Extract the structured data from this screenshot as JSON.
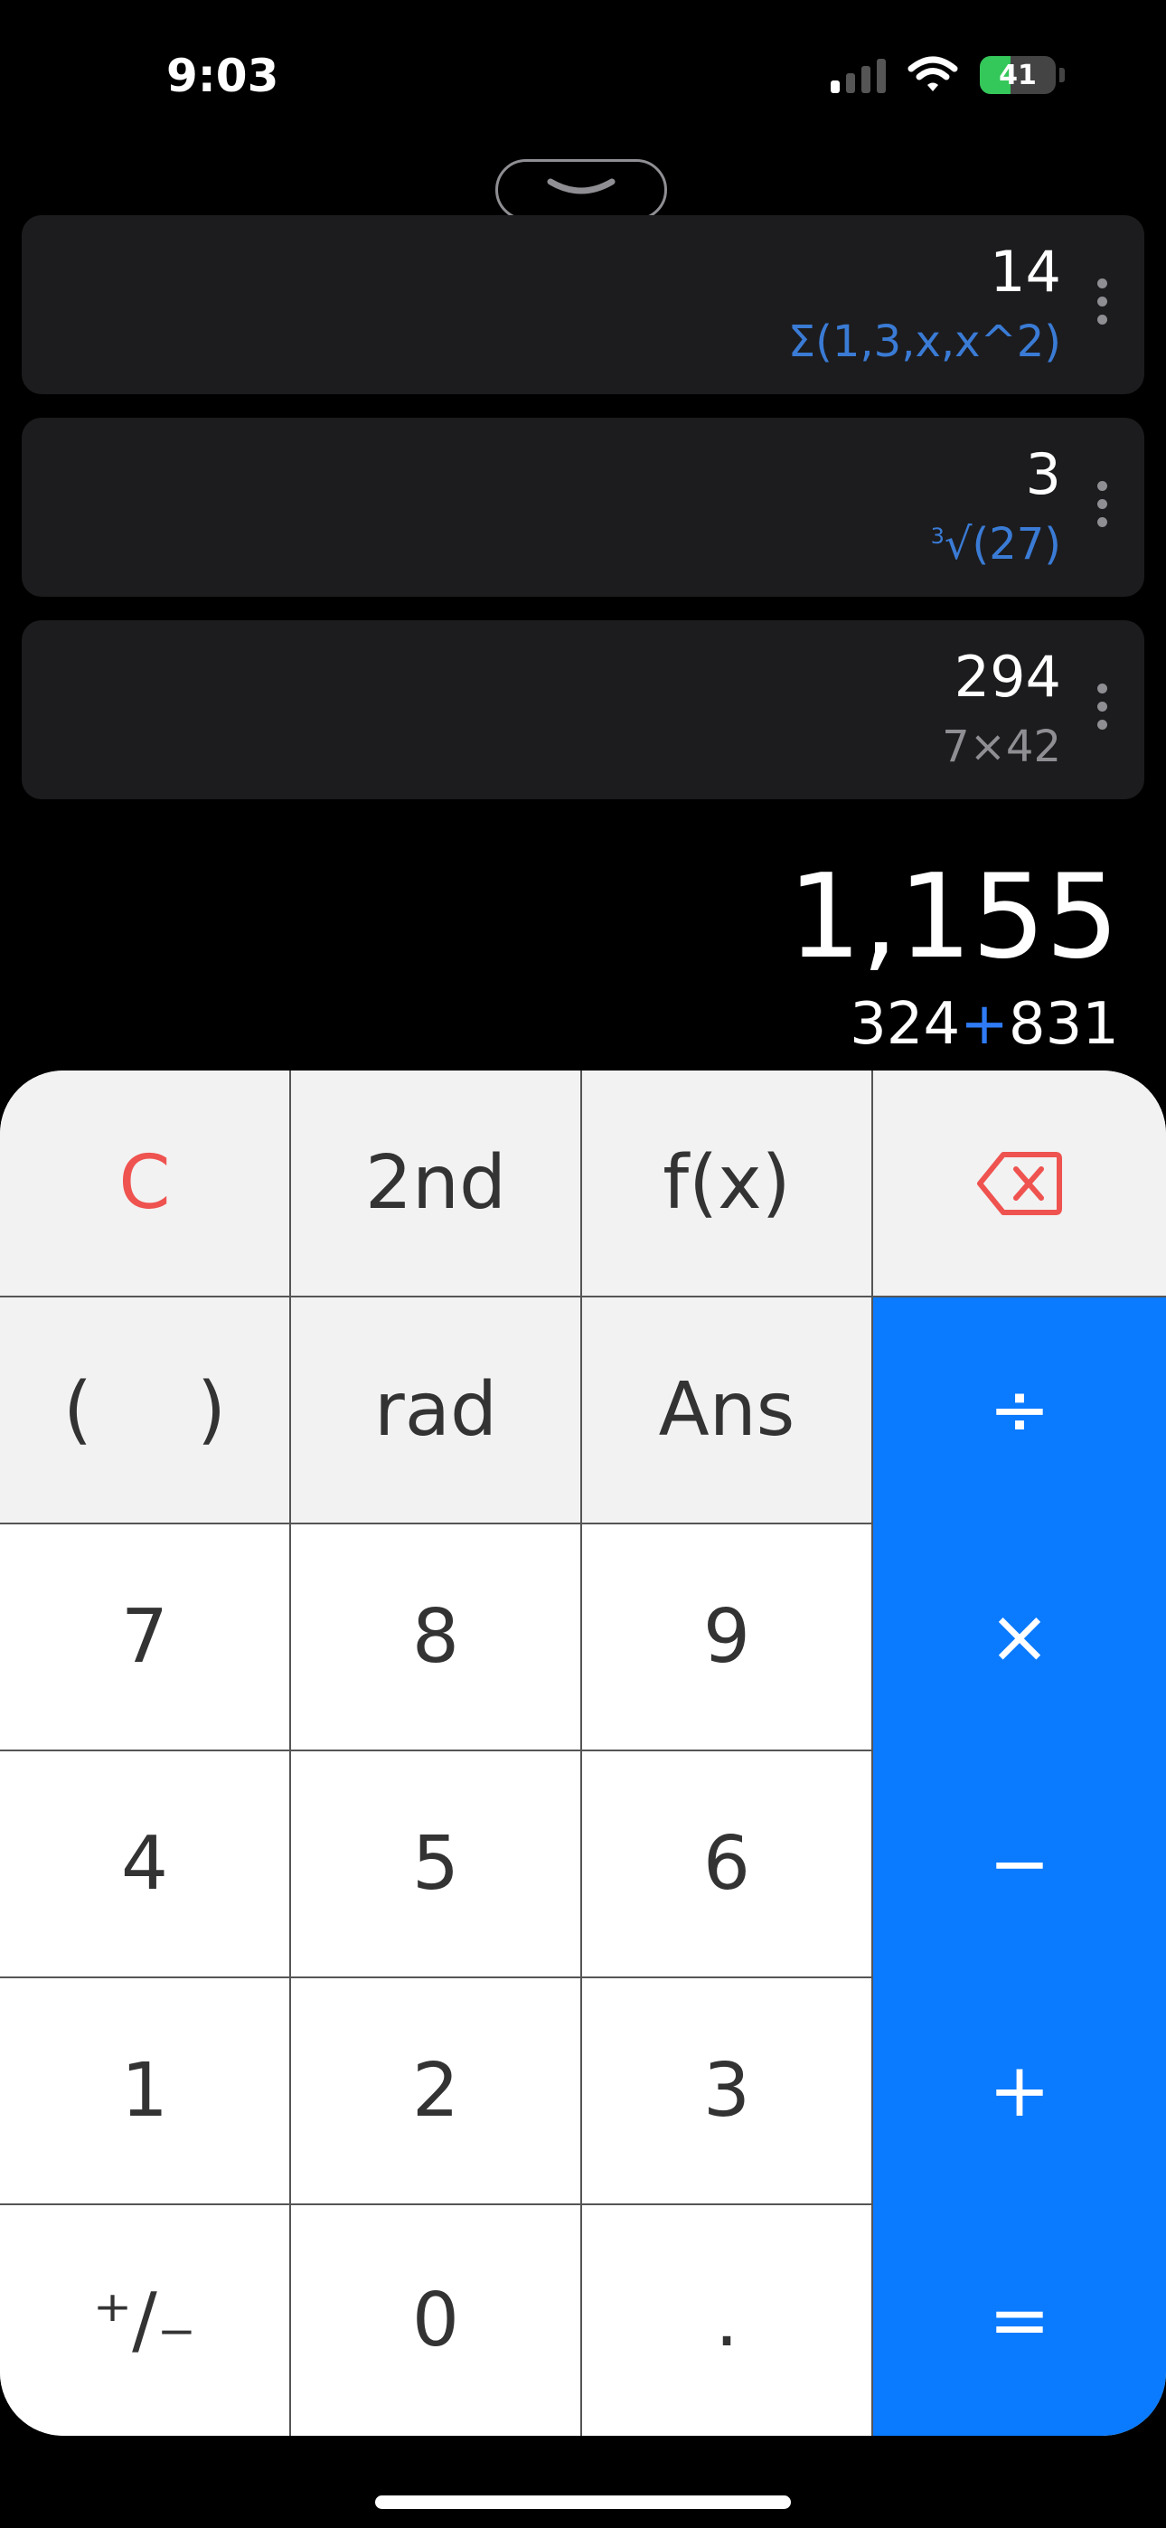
{
  "status_bar": {
    "time": "9:03",
    "battery": "41"
  },
  "history": [
    {
      "result": "14",
      "expr": "Σ(1,3,x,x^2)"
    },
    {
      "result": "3",
      "expr_index": "3",
      "expr_rest": "√(27)"
    },
    {
      "result": "294",
      "expr": "7×42"
    }
  ],
  "display": {
    "result": "1,155",
    "expr_left": "324",
    "expr_op": "+",
    "expr_right": "831"
  },
  "keys": {
    "clear": "C",
    "second": "2nd",
    "fx": "f(x)",
    "paren_open": "(",
    "paren_close": ")",
    "rad": "rad",
    "ans": "Ans",
    "divide": "÷",
    "seven": "7",
    "eight": "8",
    "nine": "9",
    "multiply": "×",
    "four": "4",
    "five": "5",
    "six": "6",
    "minus": "−",
    "one": "1",
    "two": "2",
    "three": "3",
    "plus": "+",
    "plus_minus": "⁺∕₋",
    "zero": "0",
    "dot": ".",
    "equals": "="
  },
  "colors": {
    "accent": "#0a7aff",
    "clear": "#ef5350",
    "history_blue": "#3a7bd5"
  }
}
